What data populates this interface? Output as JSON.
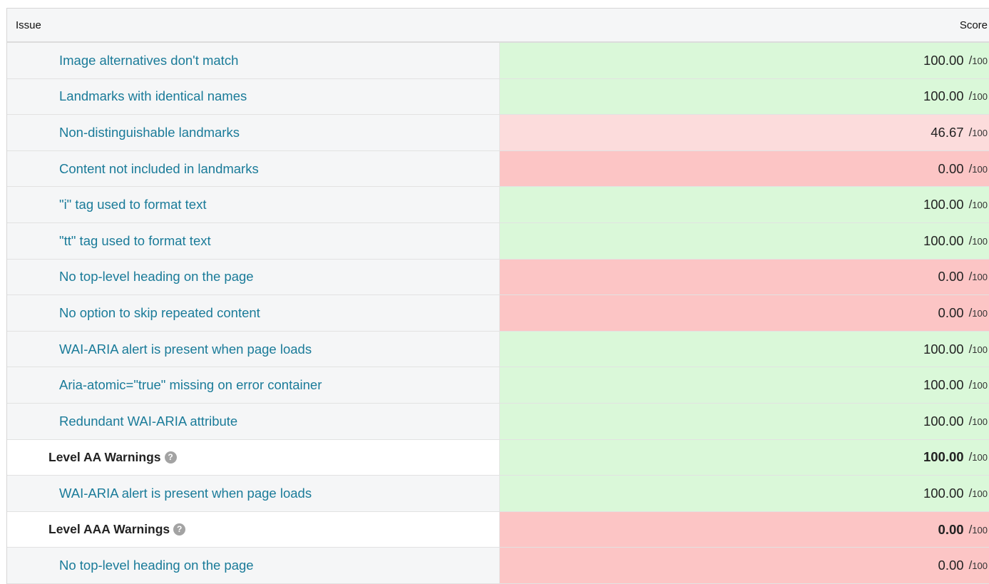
{
  "header": {
    "issue_label": "Issue",
    "score_label": "Score"
  },
  "colors": {
    "good": "#daf8d9",
    "mid": "#fcdcdc",
    "bad": "#fcc5c5",
    "link": "#1a7b99"
  },
  "rows": [
    {
      "type": "issue",
      "label": "Image alternatives don't match",
      "score": "100.00",
      "max": "100",
      "status": "good"
    },
    {
      "type": "issue",
      "label": "Landmarks with identical names",
      "score": "100.00",
      "max": "100",
      "status": "good"
    },
    {
      "type": "issue",
      "label": "Non-distinguishable landmarks",
      "score": "46.67",
      "max": "100",
      "status": "mid"
    },
    {
      "type": "issue",
      "label": "Content not included in landmarks",
      "score": "0.00",
      "max": "100",
      "status": "bad"
    },
    {
      "type": "issue",
      "label": "\"i\" tag used to format text",
      "score": "100.00",
      "max": "100",
      "status": "good"
    },
    {
      "type": "issue",
      "label": "\"tt\" tag used to format text",
      "score": "100.00",
      "max": "100",
      "status": "good"
    },
    {
      "type": "issue",
      "label": "No top-level heading on the page",
      "score": "0.00",
      "max": "100",
      "status": "bad"
    },
    {
      "type": "issue",
      "label": "No option to skip repeated content",
      "score": "0.00",
      "max": "100",
      "status": "bad"
    },
    {
      "type": "issue",
      "label": "WAI-ARIA alert is present when page loads",
      "score": "100.00",
      "max": "100",
      "status": "good"
    },
    {
      "type": "issue",
      "label": "Aria-atomic=\"true\" missing on error container",
      "score": "100.00",
      "max": "100",
      "status": "good"
    },
    {
      "type": "issue",
      "label": "Redundant WAI-ARIA attribute",
      "score": "100.00",
      "max": "100",
      "status": "good"
    },
    {
      "type": "level",
      "label": "Level AA Warnings",
      "score": "100.00",
      "max": "100",
      "status": "good",
      "icon": "help-icon"
    },
    {
      "type": "issue",
      "label": "WAI-ARIA alert is present when page loads",
      "score": "100.00",
      "max": "100",
      "status": "good"
    },
    {
      "type": "level",
      "label": "Level AAA Warnings",
      "score": "0.00",
      "max": "100",
      "status": "bad",
      "icon": "help-icon"
    },
    {
      "type": "issue",
      "label": "No top-level heading on the page",
      "score": "0.00",
      "max": "100",
      "status": "bad"
    }
  ]
}
